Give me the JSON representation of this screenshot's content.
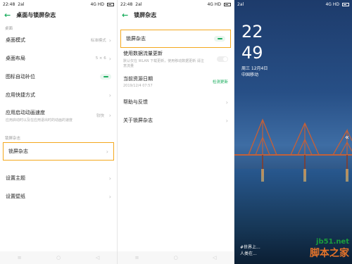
{
  "panel1": {
    "status": {
      "time": "22:48",
      "carrier": "2al",
      "right": "4G HD"
    },
    "title": "桌面与锁屏杂志",
    "section1": "桌面",
    "rows": [
      {
        "label": "桌面模式",
        "value": "标准模式"
      },
      {
        "label": "桌面布局",
        "value": "5 × 6"
      },
      {
        "label": "图标自动补位"
      },
      {
        "label": "应用快捷方式"
      },
      {
        "label": "应用启动动画速度",
        "sub": "应用启动时以及在应用退出时的动画的速度",
        "value": "较快"
      }
    ],
    "section2": "锁屏杂志",
    "magazine_label": "锁屏杂志",
    "rows2": [
      {
        "label": "设置主题"
      },
      {
        "label": "设置壁纸"
      }
    ]
  },
  "panel2": {
    "status": {
      "time": "22:48",
      "carrier": "2al",
      "right": "4G HD"
    },
    "title": "锁屏杂志",
    "magazine_label": "锁屏杂志",
    "data_update_label": "使用数据流量更新",
    "data_update_sub": "默认仅在 WLAN 下载更新，使用移动数据更新 请注意流量",
    "resource_date_label": "当前资源日期",
    "resource_date_value": "2019/12/4 07:57",
    "resource_date_status": "检测更新",
    "help_label": "帮助与反馈",
    "about_label": "关于锁屏杂志"
  },
  "lockscreen": {
    "status": {
      "carrier": "2al",
      "right": "4G HD"
    },
    "hour": "22",
    "minute": "49",
    "date": "周三  12月4日",
    "carrier_name": "中国移动",
    "caption1": "#世界上...",
    "caption2": "人类在..."
  },
  "watermark": {
    "url": "jb51.net",
    "name": "脚本之家"
  },
  "colors": {
    "accent": "#1aad5d",
    "highlight": "#f4a81d"
  },
  "icons": {
    "back": "back-arrow-icon",
    "chevron": "chevron-right-icon"
  }
}
